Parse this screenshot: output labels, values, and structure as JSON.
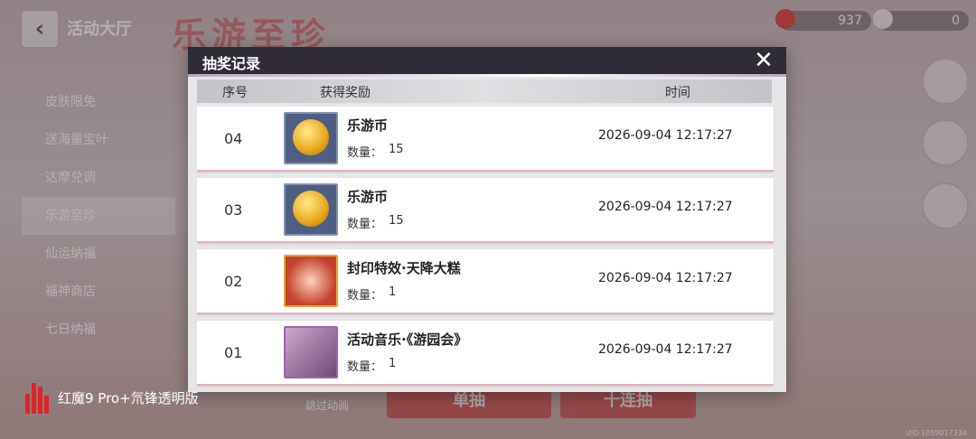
{
  "background": {
    "hall_title": "活动大厅",
    "banner_title": "乐游至珍",
    "currency_red": "937",
    "currency_white": "0",
    "side_menu": [
      "皮肤限免",
      "送海量宝叶",
      "达摩兑调",
      "乐游至珍",
      "仙运纳福",
      "福神商店",
      "七日纳福"
    ],
    "active_menu_index": 3,
    "single_draw": "单抽",
    "ten_draw": "十连抽",
    "skip_anim": "跳过动画",
    "uid": "UID:1059017334"
  },
  "watermark": {
    "text": "红魔9 Pro+氘锋透明版"
  },
  "dialog": {
    "title": "抽奖记录",
    "close_icon": "close-icon",
    "columns": {
      "index": "序号",
      "reward": "获得奖励",
      "time": "时间"
    },
    "qty_label": "数量：",
    "records": [
      {
        "num": "04",
        "name": "乐游币",
        "qty": "15",
        "time": "2026-09-04 12:17:27",
        "icon": "coin-icon"
      },
      {
        "num": "03",
        "name": "乐游币",
        "qty": "15",
        "time": "2026-09-04 12:17:27",
        "icon": "coin-icon"
      },
      {
        "num": "02",
        "name": "封印特效·天降大糕",
        "qty": "1",
        "time": "2026-09-04 12:17:27",
        "icon": "effect-icon"
      },
      {
        "num": "01",
        "name": "活动音乐·《游园会》",
        "qty": "1",
        "time": "2026-09-04 12:17:27",
        "icon": "music-icon"
      }
    ]
  }
}
